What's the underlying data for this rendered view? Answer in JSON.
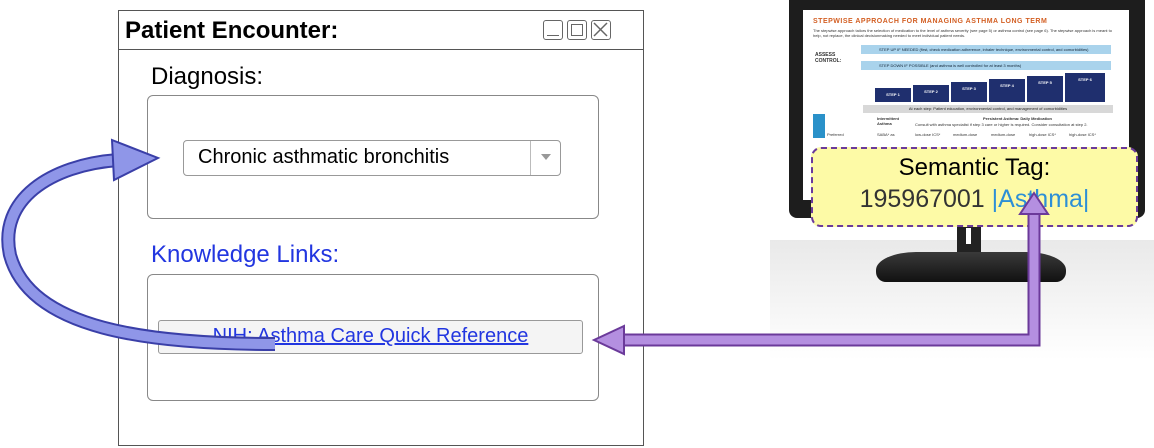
{
  "window": {
    "title": "Patient Encounter:",
    "diagnosis_label": "Diagnosis:",
    "diagnosis_value": "Chronic asthmatic bronchitis",
    "knowledge_label": "Knowledge Links:",
    "knowledge_link": "NIH: Asthma Care Quick Reference"
  },
  "monitor_document": {
    "title": "STEPWISE APPROACH FOR MANAGING ASTHMA LONG TERM",
    "subtitle": "The stepwise approach tailors the selection of medication to the level of asthma severity (see page 5) or asthma control (see page 6). The stepwise approach is meant to help, not replace, the clinical decisionmaking needed to meet individual patient needs.",
    "assess_label": "ASSESS CONTROL:",
    "step_up": "STEP UP IF NEEDED (first, check medication adherence, inhaler technique, environmental control, and comorbidities)",
    "step_down": "STEP DOWN IF POSSIBLE (and asthma is well controlled for at least 3 months)",
    "steps": [
      "STEP 1",
      "STEP 2",
      "STEP 3",
      "STEP 4",
      "STEP 5",
      "STEP 6"
    ],
    "at_each_step": "At each step: Patient education, environmental control, and management of comorbidities",
    "intermittent": "Intermittent Asthma",
    "persistent": "Persistent Asthma: Daily Medication",
    "consult": "Consult with asthma specialist if step 3 care or higher is required. Consider consultation at step 2.",
    "row_label": "Preferred",
    "row_cells": [
      "SABA* as",
      "low-dose ICS*",
      "medium-dose",
      "medium-dose",
      "high-dose ICS*",
      "high-dose ICS*"
    ]
  },
  "semantic_tag": {
    "title": "Semantic Tag:",
    "code": "195967001",
    "term": "|Asthma|"
  },
  "colors": {
    "link_blue": "#2236e0",
    "arrow_blue": "#8f96e8",
    "arrow_purple": "#b48fe0",
    "tag_fill": "#fdfaa6",
    "tag_border": "#6b3a9a"
  }
}
